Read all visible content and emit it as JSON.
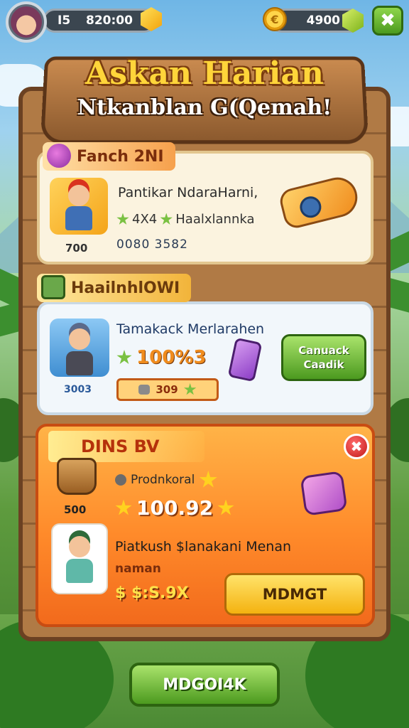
{
  "hud": {
    "level": "I5",
    "gems": "820:00",
    "coins": "4900",
    "close_icon": "✖",
    "coin_icon": "€"
  },
  "title": {
    "main": "Askan Harian",
    "sub": "Ntkanblan G(Qemah!"
  },
  "section1": {
    "tag": "Fanch 2NI",
    "card": {
      "title": "Pantikar NdaraHarni,",
      "reward_amount": "4X4",
      "reward_text": "Haalxlannka",
      "progress": "0080 3582",
      "count": "700"
    }
  },
  "section2": {
    "tag": "HaailnhlOWI",
    "card": {
      "title": "Tamakack Merlarahen",
      "percent": "100%3",
      "chip_value": "309",
      "count": "3003",
      "button_line1": "Canuack",
      "button_line2": "Caadik"
    }
  },
  "section3": {
    "tag": "DINS BV",
    "close_icon": "✖",
    "count": "500",
    "label": "Prodnkoral",
    "percent": "100.92",
    "offer_title": "Piatkush $lanakani Menan",
    "small_label": "naman",
    "price": "$ $:S.9X",
    "button": "MDMGT"
  },
  "bottom_button": "MDGOI4K",
  "colors": {
    "accent_green": "#4c9a1f",
    "accent_orange": "#f26a1c",
    "title_gold": "#ffd53a",
    "wood": "#b07a45"
  }
}
